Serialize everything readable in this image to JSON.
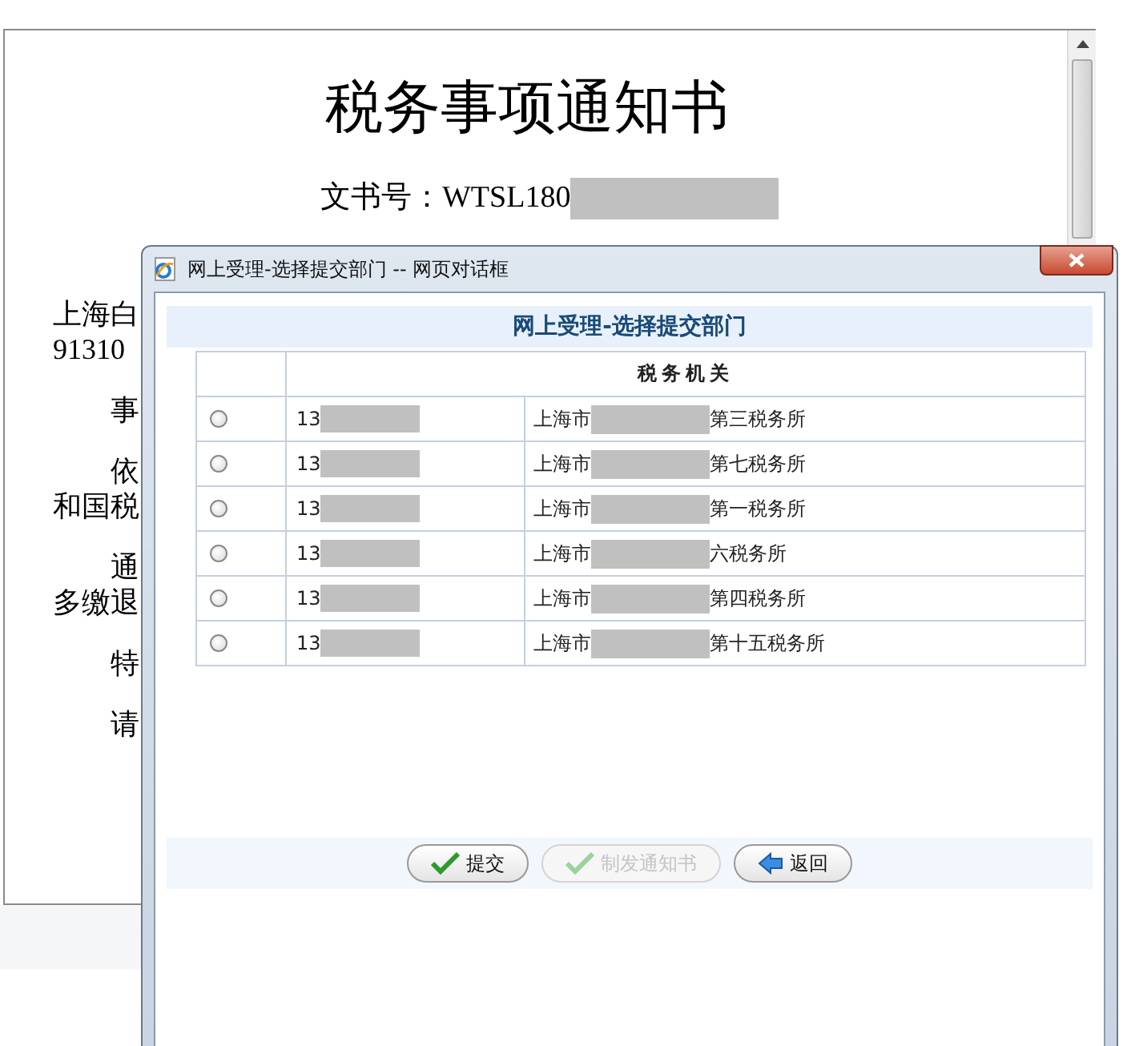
{
  "document": {
    "title": "税务事项通知书",
    "doc_number": "文书号：WTSL180",
    "addressee": [
      "上海白",
      "91310"
    ],
    "paragraphs": [
      {
        "lines": [
          "事"
        ]
      },
      {
        "lines": [
          "依",
          "和国税"
        ]
      },
      {
        "lines": [
          "通",
          "多缴退"
        ]
      },
      {
        "lines": [
          "特"
        ]
      },
      {
        "lines": [
          "请"
        ]
      }
    ]
  },
  "dialog": {
    "title": "网上受理-选择提交部门 -- 网页对话框",
    "heading": "网上受理-选择提交部门",
    "column_header": "税务机关",
    "rows": [
      {
        "selected": false,
        "code": "13",
        "office_prefix": "上海市",
        "office_suffix": "第三税务所"
      },
      {
        "selected": false,
        "code": "13",
        "office_prefix": "上海市",
        "office_suffix": "第七税务所"
      },
      {
        "selected": false,
        "code": "13",
        "office_prefix": "上海市",
        "office_suffix": "第一税务所"
      },
      {
        "selected": false,
        "code": "13",
        "office_prefix": "上海市",
        "office_suffix": "六税务所"
      },
      {
        "selected": false,
        "code": "13",
        "office_prefix": "上海市",
        "office_suffix": "第四税务所"
      },
      {
        "selected": false,
        "code": "13",
        "office_prefix": "上海市",
        "office_suffix": "第十五税务所"
      }
    ],
    "buttons": [
      {
        "label": "提交",
        "kind": "confirm",
        "disabled": false
      },
      {
        "label": "制发通知书",
        "kind": "confirm",
        "disabled": true
      },
      {
        "label": "返回",
        "kind": "back",
        "disabled": false
      }
    ]
  }
}
